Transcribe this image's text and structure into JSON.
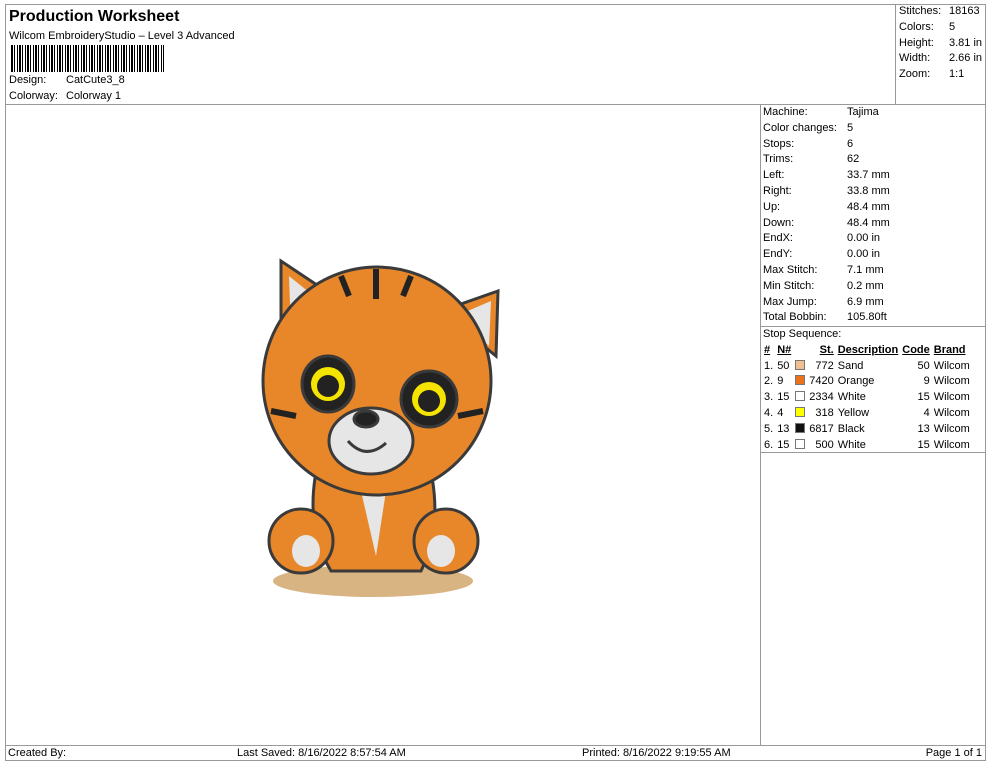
{
  "header": {
    "title": "Production Worksheet",
    "subtitle": "Wilcom EmbroideryStudio – Level 3 Advanced",
    "design_label": "Design:",
    "design": "CatCute3_8",
    "colorway_label": "Colorway:",
    "colorway": "Colorway 1"
  },
  "stats": [
    {
      "k": "Stitches:",
      "v": "18163"
    },
    {
      "k": "Colors:",
      "v": "5"
    },
    {
      "k": "Height:",
      "v": "3.81 in"
    },
    {
      "k": "Width:",
      "v": "2.66 in"
    },
    {
      "k": "Zoom:",
      "v": "1:1"
    }
  ],
  "machine": [
    {
      "k": "Machine:",
      "v": "Tajima"
    },
    {
      "k": "Color changes:",
      "v": "5"
    },
    {
      "k": "Stops:",
      "v": "6"
    },
    {
      "k": "Trims:",
      "v": "62"
    },
    {
      "k": "Left:",
      "v": "33.7 mm"
    },
    {
      "k": "Right:",
      "v": "33.8 mm"
    },
    {
      "k": "Up:",
      "v": "48.4 mm"
    },
    {
      "k": "Down:",
      "v": "48.4 mm"
    },
    {
      "k": "EndX:",
      "v": "0.00 in"
    },
    {
      "k": "EndY:",
      "v": "0.00 in"
    },
    {
      "k": "Max Stitch:",
      "v": "7.1 mm"
    },
    {
      "k": "Min Stitch:",
      "v": "0.2 mm"
    },
    {
      "k": "Max Jump:",
      "v": "6.9 mm"
    },
    {
      "k": "Total Bobbin:",
      "v": "105.80ft"
    }
  ],
  "sequence": {
    "title": "Stop Sequence:",
    "headers": [
      "#",
      "N#",
      "St.",
      "Description",
      "Code",
      "Brand"
    ],
    "rows": [
      {
        "i": "1.",
        "n": "50",
        "color": "#f2c08e",
        "st": "772",
        "desc": "Sand",
        "code": "50",
        "brand": "Wilcom"
      },
      {
        "i": "2.",
        "n": "9",
        "color": "#e8731a",
        "st": "7420",
        "desc": "Orange",
        "code": "9",
        "brand": "Wilcom"
      },
      {
        "i": "3.",
        "n": "15",
        "color": "#ffffff",
        "st": "2334",
        "desc": "White",
        "code": "15",
        "brand": "Wilcom"
      },
      {
        "i": "4.",
        "n": "4",
        "color": "#ffff00",
        "st": "318",
        "desc": "Yellow",
        "code": "4",
        "brand": "Wilcom"
      },
      {
        "i": "5.",
        "n": "13",
        "color": "#111111",
        "st": "6817",
        "desc": "Black",
        "code": "13",
        "brand": "Wilcom"
      },
      {
        "i": "6.",
        "n": "15",
        "color": "#ffffff",
        "st": "500",
        "desc": "White",
        "code": "15",
        "brand": "Wilcom"
      }
    ]
  },
  "footer": {
    "created": "Created By:",
    "saved": "Last Saved: 8/16/2022 8:57:54 AM",
    "printed": "Printed: 8/16/2022 9:19:55 AM",
    "page": "Page 1 of 1"
  }
}
